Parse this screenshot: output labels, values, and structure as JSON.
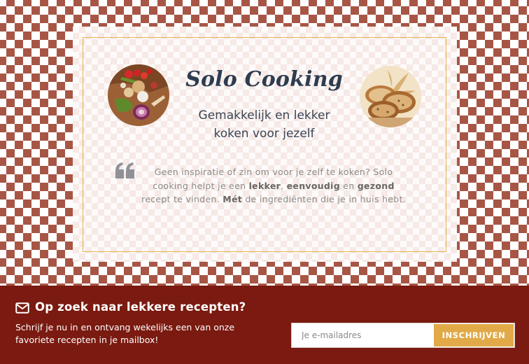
{
  "hero": {
    "title": "Solo Cooking",
    "subtitle_line1": "Gemakkelijk en lekker",
    "subtitle_line2": "koken voor jezelf"
  },
  "quote": {
    "part1": "Geen inspiratie of zin om voor je zelf te koken? Solo cooking helpt je een ",
    "bold1": "lekker",
    "part2": ", ",
    "bold2": "eenvoudig",
    "part3": " en ",
    "bold3": "gezond",
    "part4": " recept te vinden. ",
    "bold4": "Mét",
    "part5": " de ingrediënten die je in huis hebt."
  },
  "newsletter": {
    "title": "Op zoek naar lekkere recepten?",
    "description": "Schrijf je nu in en ontvang wekelijks een van onze favoriete recepten in je mailbox!",
    "email_placeholder": "Je e-mailadres",
    "email_value": "",
    "button_label": "INSCHRIJVEN"
  },
  "icons": {
    "quote": "quote-icon",
    "mail": "envelope-icon"
  },
  "colors": {
    "checker": "#a75646",
    "title": "#2e3c4f",
    "footer_bg": "#7a1a10",
    "frame": "#e6b24c",
    "button": "#e1a947"
  }
}
